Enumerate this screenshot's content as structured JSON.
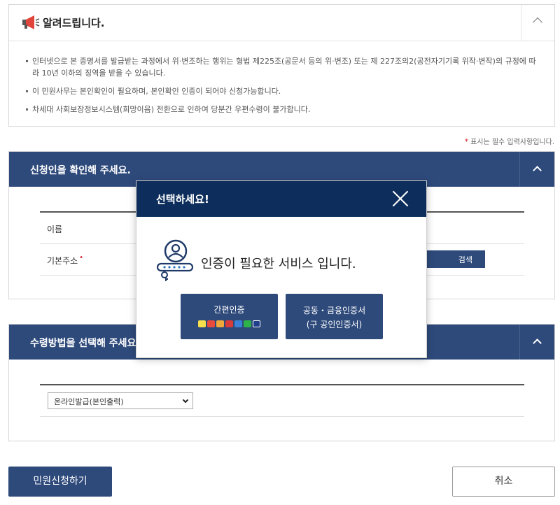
{
  "notice": {
    "title": "알려드립니다.",
    "items": [
      "인터넷으로 본 증명서를 발급받는 과정에서 위·변조하는 행위는 형법 제225조(공문서 등의 위·변조) 또는 제 227조의2(공전자기기록 위작·변작)의 규정에 따라 10년 이하의 징역을 받을 수 있습니다.",
      "이 민원사무는 본인확인이 필요하며, 본인확인 인증이 되어야 신청가능합니다.",
      "차세대 사회보장정보시스템(희망이음) 전환으로 인하여 당분간 우편수령이 불가합니다."
    ],
    "icon": "megaphone-icon"
  },
  "required_note": "표시는 필수 입력사항입니다.",
  "applicant": {
    "title": "신청인을 확인해 주세요.",
    "name_label": "이름",
    "address_label": "기본주소",
    "search_label": "검색"
  },
  "receive": {
    "title": "수령방법을 선택해 주세요.",
    "selected_option": "온라인발급(본인출력)"
  },
  "buttons": {
    "apply": "민원신청하기",
    "cancel": "취소"
  },
  "modal": {
    "title": "선택하세요!",
    "message": "인증이 필요한 서비스 입니다.",
    "simple_auth": "간편인증",
    "cert_auth_line1": "공동・금융인증서",
    "cert_auth_line2": "(구 공인인증서)"
  },
  "colors": {
    "panel_header": "#2e4a7b",
    "modal_header": "#0d2e5c",
    "required_star": "#d3242c"
  }
}
